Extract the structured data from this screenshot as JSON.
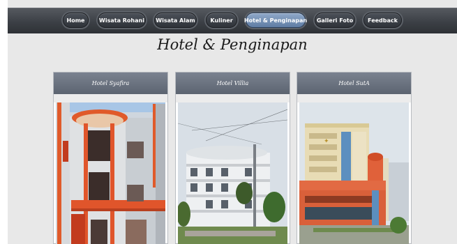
{
  "nav": {
    "items": [
      {
        "label": "Home",
        "active": false
      },
      {
        "label": "Wisata Rohani",
        "active": false
      },
      {
        "label": "Wisata Alam",
        "active": false
      },
      {
        "label": "Kuliner",
        "active": false
      },
      {
        "label": "Hotel & Penginapan",
        "active": true
      },
      {
        "label": "Galleri Foto",
        "active": false
      },
      {
        "label": "Feedback",
        "active": false
      }
    ]
  },
  "main": {
    "title": "Hotel & Penginapan",
    "cards": [
      {
        "title": "Hotel Syafira"
      },
      {
        "title": "Hotel Villia"
      },
      {
        "title": "Hotel SutA"
      }
    ]
  },
  "colors": {
    "navbar": "#3c4046",
    "nav_active": "#6f8cb4",
    "card_header": "#6b7380",
    "page_bg": "#e8e8e8"
  }
}
